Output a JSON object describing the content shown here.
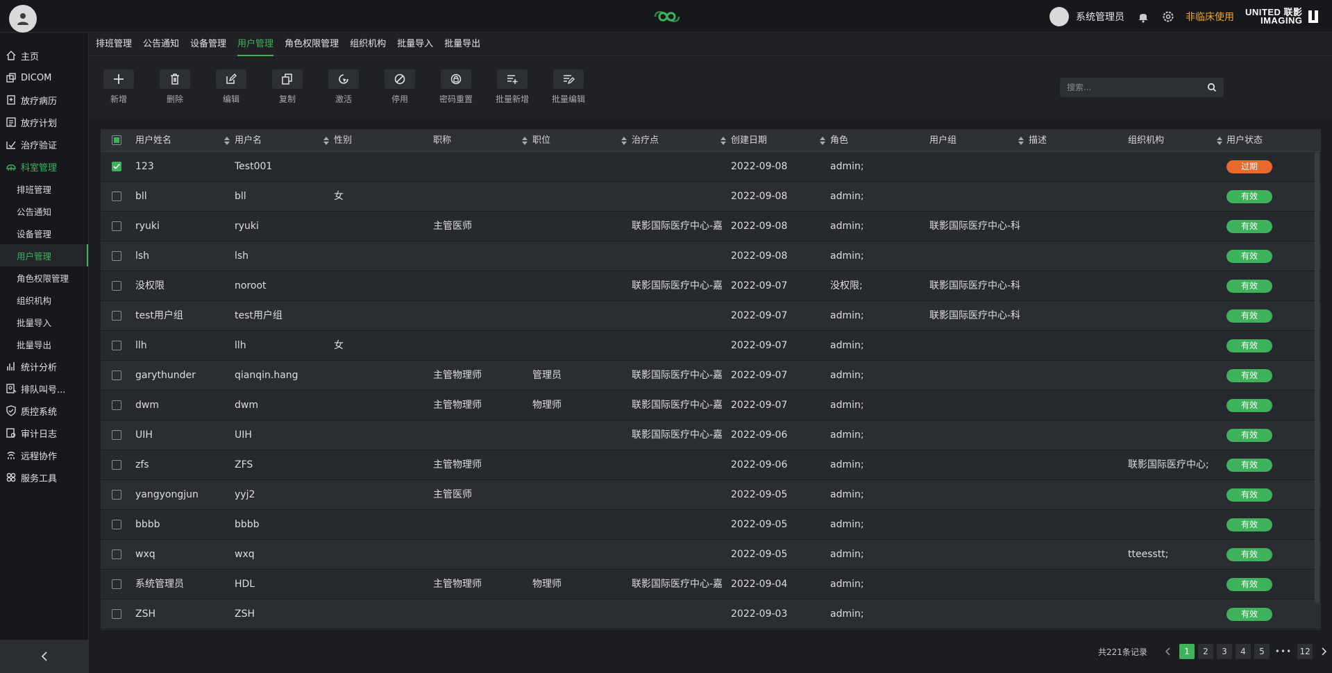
{
  "header": {
    "user_name": "系统管理员",
    "nonclinical_label": "非临床使用",
    "brand_line1": "UNITED 联影",
    "brand_line2": "IMAGING"
  },
  "sidebar": {
    "items": [
      {
        "label": "主页",
        "icon": "home-icon"
      },
      {
        "label": "DICOM",
        "icon": "dicom-icon"
      },
      {
        "label": "放疗病历",
        "icon": "medical-record-icon"
      },
      {
        "label": "放疗计划",
        "icon": "plan-icon"
      },
      {
        "label": "治疗验证",
        "icon": "verify-icon"
      },
      {
        "label": "科室管理",
        "icon": "department-icon"
      }
    ],
    "subitems": [
      "排班管理",
      "公告通知",
      "设备管理",
      "用户管理",
      "角色权限管理",
      "组织机构",
      "批量导入",
      "批量导出"
    ],
    "items_after": [
      {
        "label": "统计分析",
        "icon": "statistics-icon"
      },
      {
        "label": "排队叫号...",
        "icon": "queue-icon"
      },
      {
        "label": "质控系统",
        "icon": "shield-icon"
      },
      {
        "label": "审计日志",
        "icon": "audit-log-icon"
      },
      {
        "label": "远程协作",
        "icon": "remote-icon"
      },
      {
        "label": "服务工具",
        "icon": "tools-icon"
      }
    ]
  },
  "tabs": [
    "排班管理",
    "公告通知",
    "设备管理",
    "用户管理",
    "角色权限管理",
    "组织机构",
    "批量导入",
    "批量导出"
  ],
  "toolbar": {
    "buttons": [
      "新增",
      "删除",
      "编辑",
      "复制",
      "激活",
      "停用",
      "密码重置",
      "批量新增",
      "批量编辑"
    ]
  },
  "search": {
    "placeholder": "搜索..."
  },
  "table": {
    "columns": [
      "用户姓名",
      "用户名",
      "性别",
      "职称",
      "职位",
      "治疗点",
      "创建日期",
      "角色",
      "用户组",
      "描述",
      "组织机构",
      "用户状态"
    ],
    "rows": [
      {
        "name": "123",
        "username": "Test001",
        "gender": "",
        "title": "",
        "position": "",
        "site": "",
        "date": "2022-09-08",
        "role": "admin;",
        "group": "",
        "desc": "",
        "org": "",
        "status": "过期",
        "checked": true
      },
      {
        "name": "bll",
        "username": "bll",
        "gender": "女",
        "title": "",
        "position": "",
        "site": "",
        "date": "2022-09-08",
        "role": "admin;",
        "group": "",
        "desc": "",
        "org": "",
        "status": "有效",
        "checked": false
      },
      {
        "name": "ryuki",
        "username": "ryuki",
        "gender": "",
        "title": "主管医师",
        "position": "",
        "site": "联影国际医疗中心-嘉",
        "date": "2022-09-08",
        "role": "admin;",
        "group": "联影国际医疗中心-科",
        "desc": "",
        "org": "",
        "status": "有效",
        "checked": false
      },
      {
        "name": "lsh",
        "username": "lsh",
        "gender": "",
        "title": "",
        "position": "",
        "site": "",
        "date": "2022-09-08",
        "role": "admin;",
        "group": "",
        "desc": "",
        "org": "",
        "status": "有效",
        "checked": false
      },
      {
        "name": "没权限",
        "username": "noroot",
        "gender": "",
        "title": "",
        "position": "",
        "site": "联影国际医疗中心-嘉",
        "date": "2022-09-07",
        "role": "没权限;",
        "group": "联影国际医疗中心-科",
        "desc": "",
        "org": "",
        "status": "有效",
        "checked": false
      },
      {
        "name": "test用户组",
        "username": "test用户组",
        "gender": "",
        "title": "",
        "position": "",
        "site": "",
        "date": "2022-09-07",
        "role": "admin;",
        "group": "联影国际医疗中心-科",
        "desc": "",
        "org": "",
        "status": "有效",
        "checked": false
      },
      {
        "name": "llh",
        "username": "llh",
        "gender": "女",
        "title": "",
        "position": "",
        "site": "",
        "date": "2022-09-07",
        "role": "admin;",
        "group": "",
        "desc": "",
        "org": "",
        "status": "有效",
        "checked": false
      },
      {
        "name": "garythunder",
        "username": "qianqin.hang",
        "gender": "",
        "title": "主管物理师",
        "position": "管理员",
        "site": "联影国际医疗中心-嘉",
        "date": "2022-09-07",
        "role": "admin;",
        "group": "",
        "desc": "",
        "org": "",
        "status": "有效",
        "checked": false
      },
      {
        "name": "dwm",
        "username": "dwm",
        "gender": "",
        "title": "主管物理师",
        "position": "物理师",
        "site": "联影国际医疗中心-嘉",
        "date": "2022-09-07",
        "role": "admin;",
        "group": "",
        "desc": "",
        "org": "",
        "status": "有效",
        "checked": false
      },
      {
        "name": "UIH",
        "username": "UIH",
        "gender": "",
        "title": "",
        "position": "",
        "site": "联影国际医疗中心-嘉",
        "date": "2022-09-06",
        "role": "admin;",
        "group": "",
        "desc": "",
        "org": "",
        "status": "有效",
        "checked": false
      },
      {
        "name": "zfs",
        "username": "ZFS",
        "gender": "",
        "title": "主管物理师",
        "position": "",
        "site": "",
        "date": "2022-09-06",
        "role": "admin;",
        "group": "",
        "desc": "",
        "org": "联影国际医疗中心;",
        "status": "有效",
        "checked": false
      },
      {
        "name": "yangyongjun",
        "username": "yyj2",
        "gender": "",
        "title": "主管医师",
        "position": "",
        "site": "",
        "date": "2022-09-05",
        "role": "admin;",
        "group": "",
        "desc": "",
        "org": "",
        "status": "有效",
        "checked": false
      },
      {
        "name": "bbbb",
        "username": "bbbb",
        "gender": "",
        "title": "",
        "position": "",
        "site": "",
        "date": "2022-09-05",
        "role": "admin;",
        "group": "",
        "desc": "",
        "org": "",
        "status": "有效",
        "checked": false
      },
      {
        "name": "wxq",
        "username": "wxq",
        "gender": "",
        "title": "",
        "position": "",
        "site": "",
        "date": "2022-09-05",
        "role": "admin;",
        "group": "",
        "desc": "",
        "org": "tteesstt;",
        "status": "有效",
        "checked": false
      },
      {
        "name": "系统管理员",
        "username": "HDL",
        "gender": "",
        "title": "主管物理师",
        "position": "物理师",
        "site": "联影国际医疗中心-嘉",
        "date": "2022-09-04",
        "role": "admin;",
        "group": "",
        "desc": "",
        "org": "",
        "status": "有效",
        "checked": false
      },
      {
        "name": "ZSH",
        "username": "ZSH",
        "gender": "",
        "title": "",
        "position": "",
        "site": "",
        "date": "2022-09-03",
        "role": "admin;",
        "group": "",
        "desc": "",
        "org": "",
        "status": "有效",
        "checked": false
      }
    ]
  },
  "pagination": {
    "total": "共221条记录",
    "pages": [
      "1",
      "2",
      "3",
      "4",
      "5"
    ],
    "dots": "•••",
    "last": "12",
    "current": "1"
  },
  "colors": {
    "accent": "#3fb35b",
    "expired": "#e8692c",
    "valid": "#3fb35b",
    "warning_text": "#f5a623"
  }
}
